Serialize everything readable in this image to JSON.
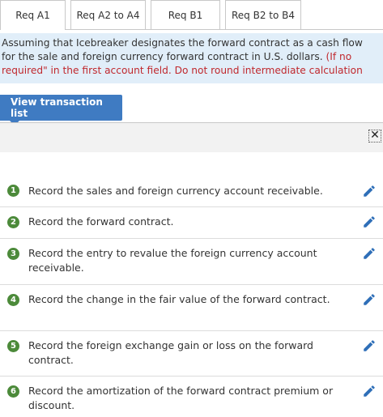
{
  "tabs": [
    {
      "label": "Req A1",
      "active": true
    },
    {
      "label": "Req A2 to A4",
      "active": false
    },
    {
      "label": "Req B1",
      "active": false
    },
    {
      "label": "Req B2 to B4",
      "active": false
    }
  ],
  "instructions": {
    "line1": "Assuming that Icebreaker designates the forward contract as a cash flow",
    "line2_black": "for the sale and foreign currency forward contract in U.S. dollars. ",
    "line2_red": "(If no",
    "line3_red": "required\" in the first account field. Do not round intermediate calculation"
  },
  "view_button": {
    "label": "View transaction list"
  },
  "panel": {
    "close_icon": "close-icon"
  },
  "entries": [
    {
      "num": "1",
      "text": "Record the sales and foreign currency account receivable."
    },
    {
      "num": "2",
      "text": "Record the forward contract."
    },
    {
      "num": "3",
      "text": "Record the entry to revalue the foreign currency account receivable."
    },
    {
      "num": "4",
      "text": "Record the change in the fair value of the forward contract."
    },
    {
      "num": "5",
      "text": "Record the foreign exchange gain or loss on the forward contract."
    },
    {
      "num": "6",
      "text": "Record the amortization of the forward contract premium or discount."
    }
  ],
  "colors": {
    "accent": "#3f7bc2",
    "badge": "#4c8a3a",
    "banner": "#e1eef9",
    "red_note": "#c0282d",
    "pencil": "#2f6fb8"
  }
}
